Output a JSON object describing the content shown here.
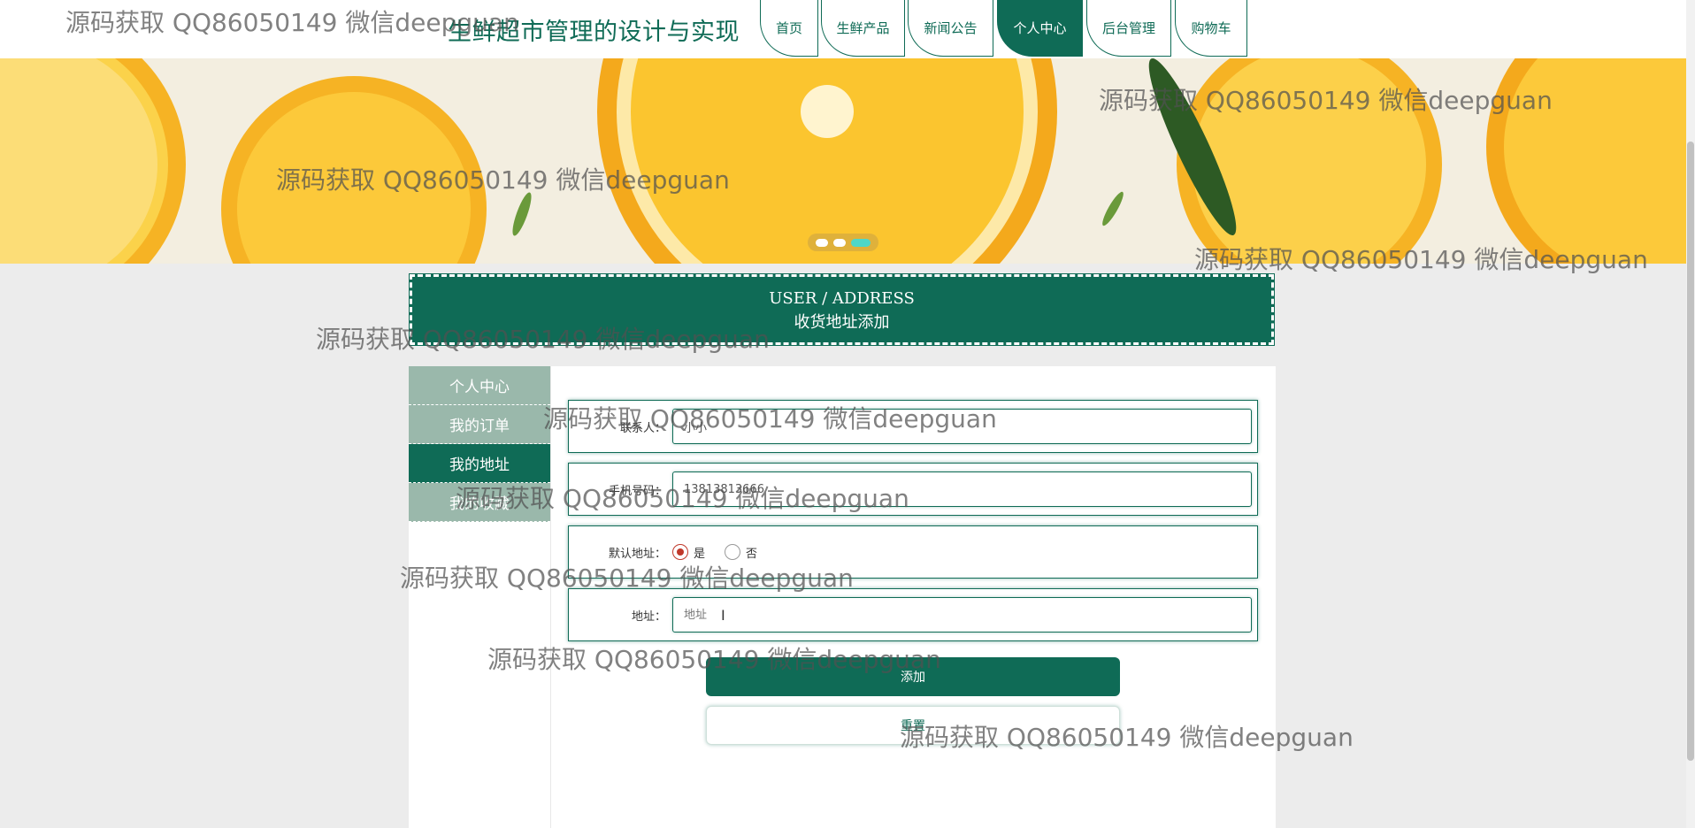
{
  "header": {
    "site_title": "生鲜超市管理的设计与实现",
    "nav": [
      {
        "label": "首页",
        "active": false
      },
      {
        "label": "生鲜产品",
        "active": false
      },
      {
        "label": "新闻公告",
        "active": false
      },
      {
        "label": "个人中心",
        "active": true
      },
      {
        "label": "后台管理",
        "active": false
      },
      {
        "label": "购物车",
        "active": false
      }
    ]
  },
  "banner": {
    "carousel_dots": 3,
    "active_dot": 3
  },
  "title_box": {
    "english": "USER / ADDRESS",
    "chinese": "收货地址添加"
  },
  "side_menu": {
    "items": [
      {
        "label": "个人中心",
        "active": false
      },
      {
        "label": "我的订单",
        "active": false
      },
      {
        "label": "我的地址",
        "active": true
      },
      {
        "label": "我的收藏",
        "active": false
      }
    ]
  },
  "form": {
    "contact": {
      "label": "联系人：",
      "value": "小小"
    },
    "phone": {
      "label": "手机号码：",
      "value": "13813813666"
    },
    "default_address": {
      "label": "默认地址：",
      "options": [
        {
          "label": "是",
          "selected": true
        },
        {
          "label": "否",
          "selected": false
        }
      ]
    },
    "address": {
      "label": "地址：",
      "placeholder": "地址",
      "value": ""
    },
    "add_button": "添加",
    "reset_button": "重置"
  },
  "watermark": "源码获取 QQ86050149 微信deepguan",
  "colors": {
    "primary": "#0f6b56",
    "menu_inactive": "#9ab8ab",
    "page_bg": "#ececec",
    "radio_selected": "#c0392b"
  }
}
